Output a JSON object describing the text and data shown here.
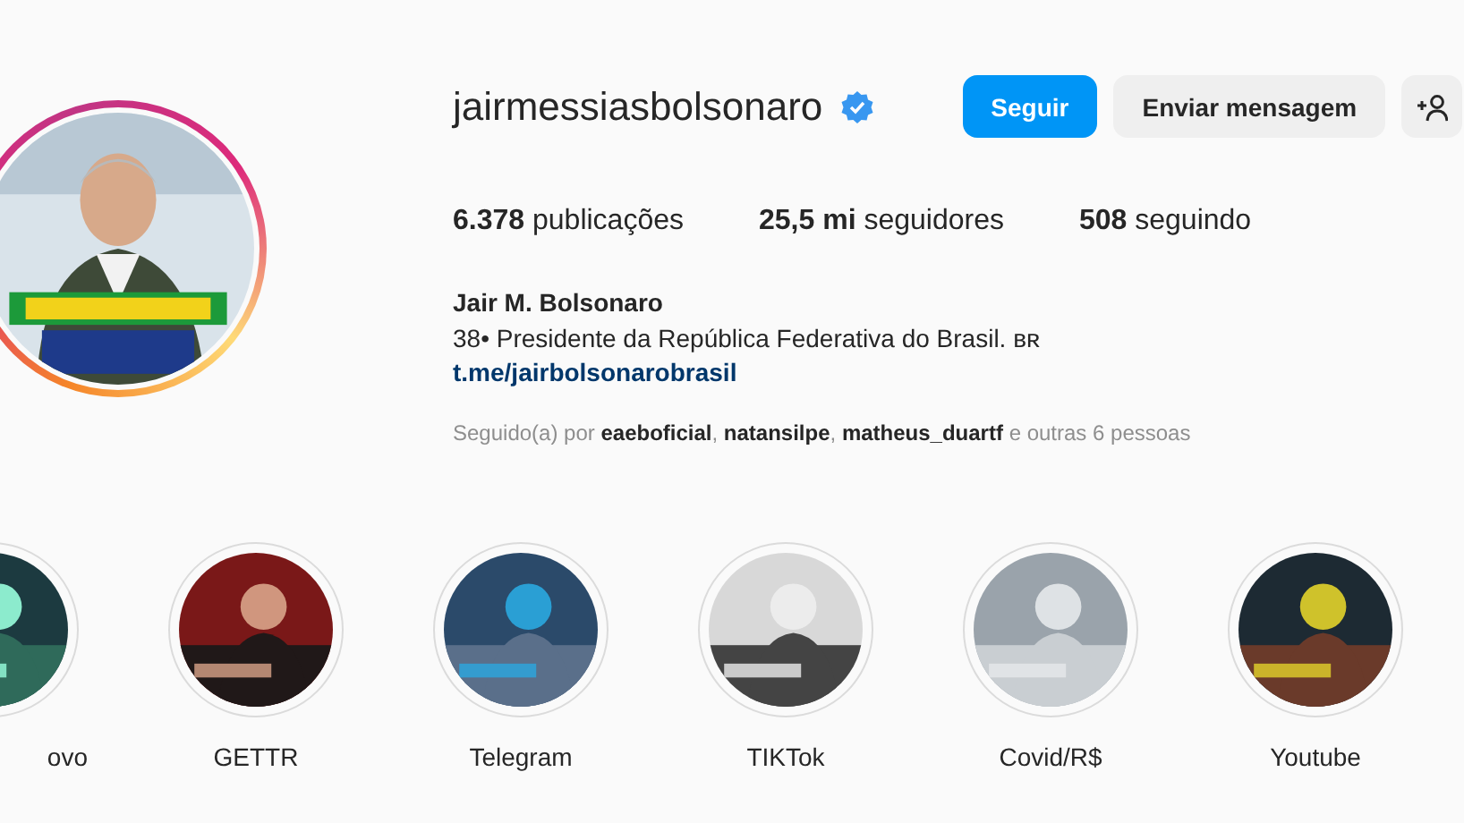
{
  "profile": {
    "username": "jairmessiasbolsonaro",
    "verified": true,
    "buttons": [
      {
        "label": "Seguir",
        "kind": "primary"
      },
      {
        "label": "Enviar mensagem",
        "kind": "secondary"
      },
      {
        "kind": "add-person"
      }
    ],
    "stats": [
      "**6.378** publicações",
      "**25,5 mi** seguidores",
      "**508** seguindo"
    ],
    "name": "Jair M. Bolsonaro",
    "bio": "38• Presidente da República Federativa do Brasil. ʙʀ",
    "link": "t.me/jairbolsonarobrasil",
    "followed_by": "Seguido(a) por **eaeboficial**, **natansilpe**, **matheus_duartf** e outras 6 pessoas"
  },
  "highlights": [
    {
      "label": "ovo"
    },
    {
      "label": "GETTR"
    },
    {
      "label": "Telegram"
    },
    {
      "label": "TIKTok"
    },
    {
      "label": "Covid/R$"
    },
    {
      "label": "Youtube"
    }
  ]
}
